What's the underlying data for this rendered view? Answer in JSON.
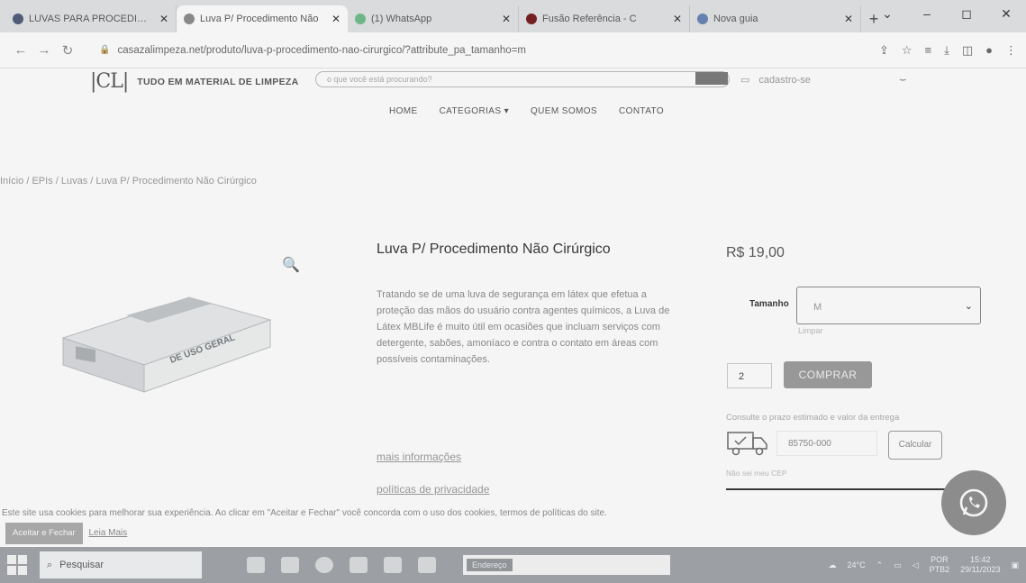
{
  "browser": {
    "tabs": [
      {
        "title": "LUVAS PARA PROCEDIMENTO",
        "active": false,
        "fav_color": "#3c5a99"
      },
      {
        "title": "Luva P/ Procedimento Não",
        "active": true,
        "fav_color": "#8a8a8a"
      },
      {
        "title": "(1) WhatsApp",
        "active": false,
        "fav_color": "#25d366"
      },
      {
        "title": "Fusão Referência - C",
        "active": false,
        "fav_color": "#c00"
      },
      {
        "title": "Nova guia",
        "active": false,
        "fav_color": "#4285f4"
      }
    ],
    "url": "casazalimpeza.net/produto/luva-p-procedimento-nao-cirurgico/?attribute_pa_tamanho=m"
  },
  "site": {
    "logo_mark": "|CL|",
    "logo_tagline": "TUDO EM MATERIAL DE LIMPEZA",
    "search_placeholder": "o que você está procurando?",
    "account_link": "cadastro-se",
    "nav": [
      "HOME",
      "CATEGORIAS ▾",
      "QUEM SOMOS",
      "CONTATO"
    ]
  },
  "breadcrumb": "Início / EPIs / Luvas / Luva P/ Procedimento Não Cirúrgico",
  "product": {
    "title": "Luva P/ Procedimento Não Cirúrgico",
    "description": "Tratando se de uma luva de segurança em látex que efetua a proteção das mãos do usuário contra agentes químicos, a Luva de Látex MBLife é muito útil em ocasiões que incluam serviços com detergente, sabões, amoníaco e contra o contato em áreas com possíveis contaminações.",
    "box_label": "DE USO GERAL",
    "more_info": "mais informações",
    "privacy": "políticas de privacidade",
    "price": "R$ 19,00",
    "size_label": "Tamanho",
    "size_value": "M",
    "clear_label": "Limpar",
    "quantity": "2",
    "buy_label": "COMPRAR",
    "shipping_note": "Consulte o prazo estimado e valor da entrega",
    "cep_value": "85750-000",
    "calc_label": "Calcular",
    "no_cep": "Não sei meu CEP"
  },
  "cookie": {
    "text": "Este site usa cookies para melhorar sua experiência. Ao clicar em \"Aceitar e Fechar\" você concorda com o uso dos cookies, termos de políticas do site.",
    "accept_label": "Aceitar e Fechar",
    "learn_more": "Leia Mais"
  },
  "taskbar": {
    "search_placeholder": "Pesquisar",
    "address_label": "Endereço",
    "weather": "24°C",
    "lang": "POR",
    "lang2": "PTB2",
    "time": "15:42",
    "date": "29/11/2023"
  }
}
